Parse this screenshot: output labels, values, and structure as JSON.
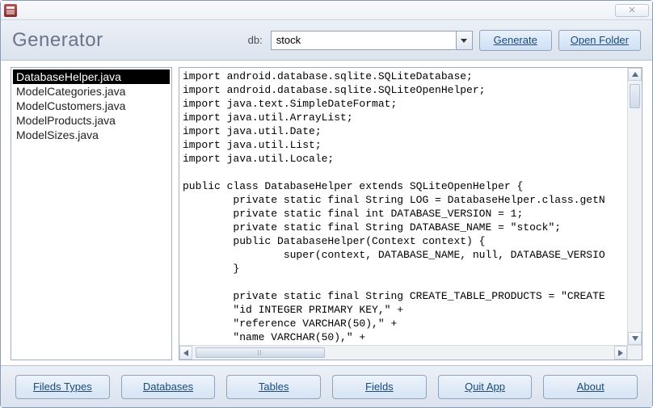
{
  "window": {
    "close_glyph": "✕"
  },
  "header": {
    "title": "Generator",
    "db_label": "db:",
    "db_value": "stock",
    "generate_label": "Generate",
    "openfolder_label": "Open Folder"
  },
  "filelist": {
    "items": [
      {
        "label": "DatabaseHelper.java",
        "selected": true
      },
      {
        "label": "ModelCategories.java",
        "selected": false
      },
      {
        "label": "ModelCustomers.java",
        "selected": false
      },
      {
        "label": "ModelProducts.java",
        "selected": false
      },
      {
        "label": "ModelSizes.java",
        "selected": false
      }
    ]
  },
  "code": {
    "lines": [
      "import android.database.sqlite.SQLiteDatabase;",
      "import android.database.sqlite.SQLiteOpenHelper;",
      "import java.text.SimpleDateFormat;",
      "import java.util.ArrayList;",
      "import java.util.Date;",
      "import java.util.List;",
      "import java.util.Locale;",
      "",
      "public class DatabaseHelper extends SQLiteOpenHelper {",
      "        private static final String LOG = DatabaseHelper.class.getN",
      "        private static final int DATABASE_VERSION = 1;",
      "        private static final String DATABASE_NAME = \"stock\";",
      "        public DatabaseHelper(Context context) {",
      "                super(context, DATABASE_NAME, null, DATABASE_VERSIO",
      "        }",
      "",
      "        private static final String CREATE_TABLE_PRODUCTS = \"CREATE",
      "        \"id INTEGER PRIMARY KEY,\" +",
      "        \"reference VARCHAR(50),\" +",
      "        \"name VARCHAR(50),\" +"
    ]
  },
  "footer": {
    "buttons": [
      "Fileds Types",
      "Databases",
      "Tables",
      "Fields",
      "Quit App",
      "About"
    ]
  }
}
